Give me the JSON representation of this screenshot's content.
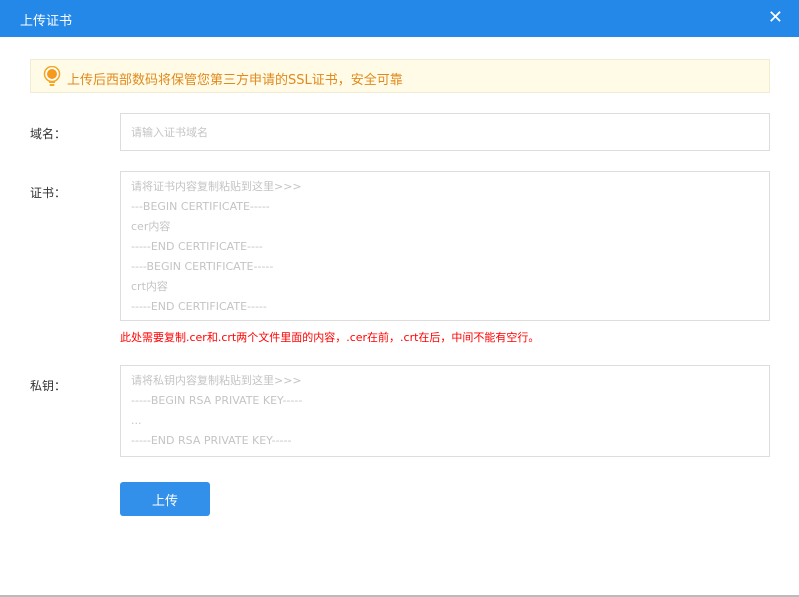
{
  "dialog": {
    "title": "上传证书",
    "close_icon": "close-icon"
  },
  "notice": {
    "icon": "lightbulb-icon",
    "text": "上传后西部数码将保管您第三方申请的SSL证书，安全可靠"
  },
  "form": {
    "domain": {
      "label": "域名：",
      "value": "",
      "placeholder": "请输入证书域名"
    },
    "certificate": {
      "label": "证书：",
      "value": "",
      "placeholder": "请将证书内容复制粘贴到这里>>>\n---BEGIN CERTIFICATE-----\ncer内容\n-----END CERTIFICATE----\n----BEGIN CERTIFICATE-----\ncrt内容\n-----END CERTIFICATE-----",
      "hint": "此处需要复制.cer和.crt两个文件里面的内容，.cer在前，.crt在后，中间不能有空行。"
    },
    "private_key": {
      "label": "私钥：",
      "value": "",
      "placeholder": "请将私钥内容复制粘贴到这里>>>\n-----BEGIN RSA PRIVATE KEY-----\n...\n-----END RSA PRIVATE KEY-----"
    },
    "submit_label": "上传"
  },
  "colors": {
    "header": "#2488e8",
    "button": "#3390ea",
    "hint": "#ff0000",
    "notice_bg": "#fffbe6",
    "notice_text": "#e08a1e"
  }
}
